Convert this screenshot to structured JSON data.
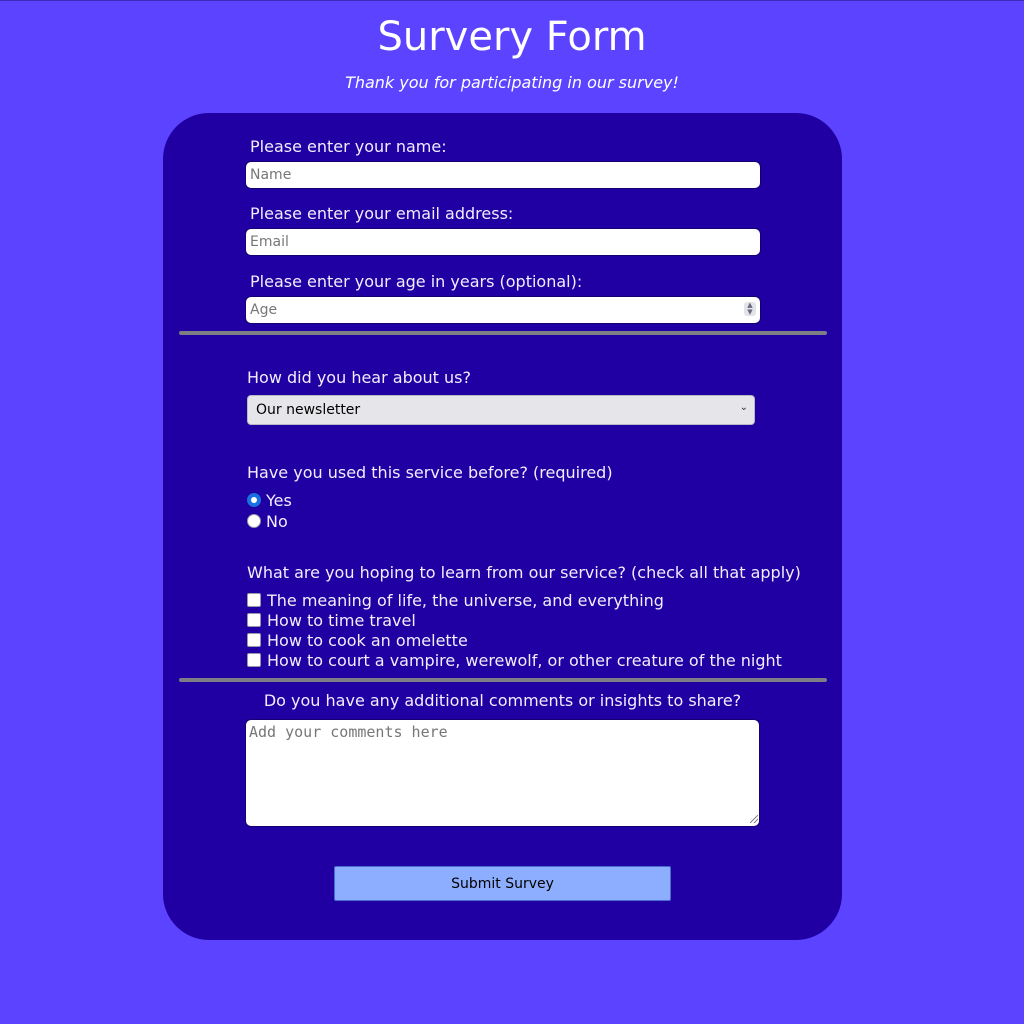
{
  "header": {
    "title": "Survery Form",
    "subtitle": "Thank you for participating in our survey!"
  },
  "form": {
    "name": {
      "label": "Please enter your name:",
      "placeholder": "Name"
    },
    "email": {
      "label": "Please enter your email address:",
      "placeholder": "Email"
    },
    "age": {
      "label": "Please enter your age in years (optional):",
      "placeholder": "Age"
    },
    "referral": {
      "label": "How did you hear about us?",
      "selected": "Our newsletter"
    },
    "used_before": {
      "label": "Have you used this service before? (required)",
      "options": [
        {
          "label": "Yes",
          "checked": true
        },
        {
          "label": "No",
          "checked": false
        }
      ]
    },
    "learn": {
      "label": "What are you hoping to learn from our service? (check all that apply)",
      "options": [
        {
          "label": "The meaning of life, the universe, and everything",
          "checked": false
        },
        {
          "label": "How to time travel",
          "checked": false
        },
        {
          "label": "How to cook an omelette",
          "checked": false
        },
        {
          "label": "How to court a vampire, werewolf, or other creature of the night",
          "checked": false
        }
      ]
    },
    "comments": {
      "label": "Do you have any additional comments or insights to share?",
      "placeholder": "Add your comments here"
    },
    "submit_label": "Submit Survey"
  },
  "colors": {
    "page_background": "#5b43ff",
    "card_background": "#2000a2",
    "submit_button": "#8daeff"
  }
}
